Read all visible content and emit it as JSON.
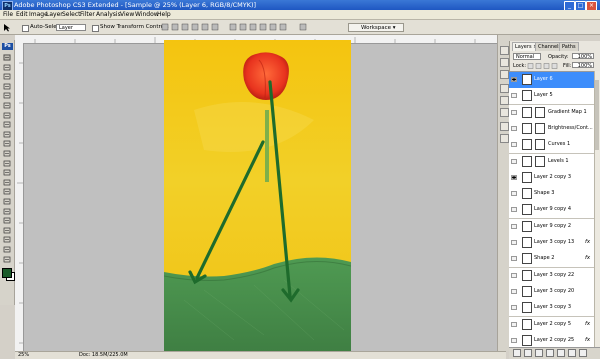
{
  "window": {
    "title": "Adobe Photoshop CS3 Extended - [Sample @ 25% (Layer 6, RGB/8/CMYK)]",
    "app_icon": "Ps",
    "minimize": "_",
    "maximize": "□",
    "close": "×"
  },
  "menu": [
    "File",
    "Edit",
    "Image",
    "Layer",
    "Select",
    "Filter",
    "Analysis",
    "View",
    "Window",
    "Help"
  ],
  "options": {
    "auto_select_label": "Auto-Select:",
    "auto_select_value": "Layer",
    "transform_label": "Show Transform Controls",
    "workspace_label": "Workspace ▾"
  },
  "toolbox": {
    "badge": "Ps",
    "foreground_color": "#1a5b2a",
    "background_color": "#ffffff"
  },
  "status": {
    "zoom": "25%",
    "doc": "Doc: 18.5M/225.0M"
  },
  "layers_panel": {
    "tabs": [
      "Layers ×",
      "Channels",
      "Paths"
    ],
    "blend_mode": "Normal",
    "opacity_label": "Opacity:",
    "opacity_value": "100%",
    "lock_label": "Lock:",
    "fill_label": "Fill:",
    "fill_value": "100%",
    "layers": [
      {
        "name": "Layer 6",
        "selected": true,
        "visible": true,
        "fx": false,
        "mask": false
      },
      {
        "name": "Layer 5",
        "selected": false,
        "visible": false,
        "fx": false,
        "mask": false
      },
      {
        "name": "Gradient Map 1",
        "selected": false,
        "visible": false,
        "fx": false,
        "mask": true
      },
      {
        "name": "Brightness/Cont...",
        "selected": false,
        "visible": false,
        "fx": false,
        "mask": true
      },
      {
        "name": "Curves 1",
        "selected": false,
        "visible": false,
        "fx": false,
        "mask": true
      },
      {
        "name": "Levels 1",
        "selected": false,
        "visible": false,
        "fx": false,
        "mask": true
      },
      {
        "name": "Layer 2 copy 3",
        "selected": false,
        "visible": true,
        "fx": false,
        "mask": false
      },
      {
        "name": "Shape 3",
        "selected": false,
        "visible": false,
        "fx": false,
        "mask": false
      },
      {
        "name": "Layer 9 copy 4",
        "selected": false,
        "visible": false,
        "fx": false,
        "mask": false
      },
      {
        "name": "Layer 9 copy 2",
        "selected": false,
        "visible": false,
        "fx": false,
        "mask": false
      },
      {
        "name": "Layer 3 copy 13",
        "selected": false,
        "visible": false,
        "fx": true,
        "mask": false
      },
      {
        "name": "Shape 2",
        "selected": false,
        "visible": false,
        "fx": true,
        "mask": false
      },
      {
        "name": "Layer 3 copy 22",
        "selected": false,
        "visible": false,
        "fx": false,
        "mask": false
      },
      {
        "name": "Layer 3 copy 20",
        "selected": false,
        "visible": false,
        "fx": false,
        "mask": false
      },
      {
        "name": "Layer 3 copy 3",
        "selected": false,
        "visible": false,
        "fx": false,
        "mask": false
      },
      {
        "name": "Layer 2 copy 5",
        "selected": false,
        "visible": false,
        "fx": true,
        "mask": false
      },
      {
        "name": "Layer 2 copy 25",
        "selected": false,
        "visible": false,
        "fx": true,
        "mask": false
      }
    ],
    "fx_label": "fx"
  },
  "colors": {
    "selection": "#3d8dfb",
    "titlebar": "#1f57c2",
    "arrow": "#1e6b2c"
  }
}
